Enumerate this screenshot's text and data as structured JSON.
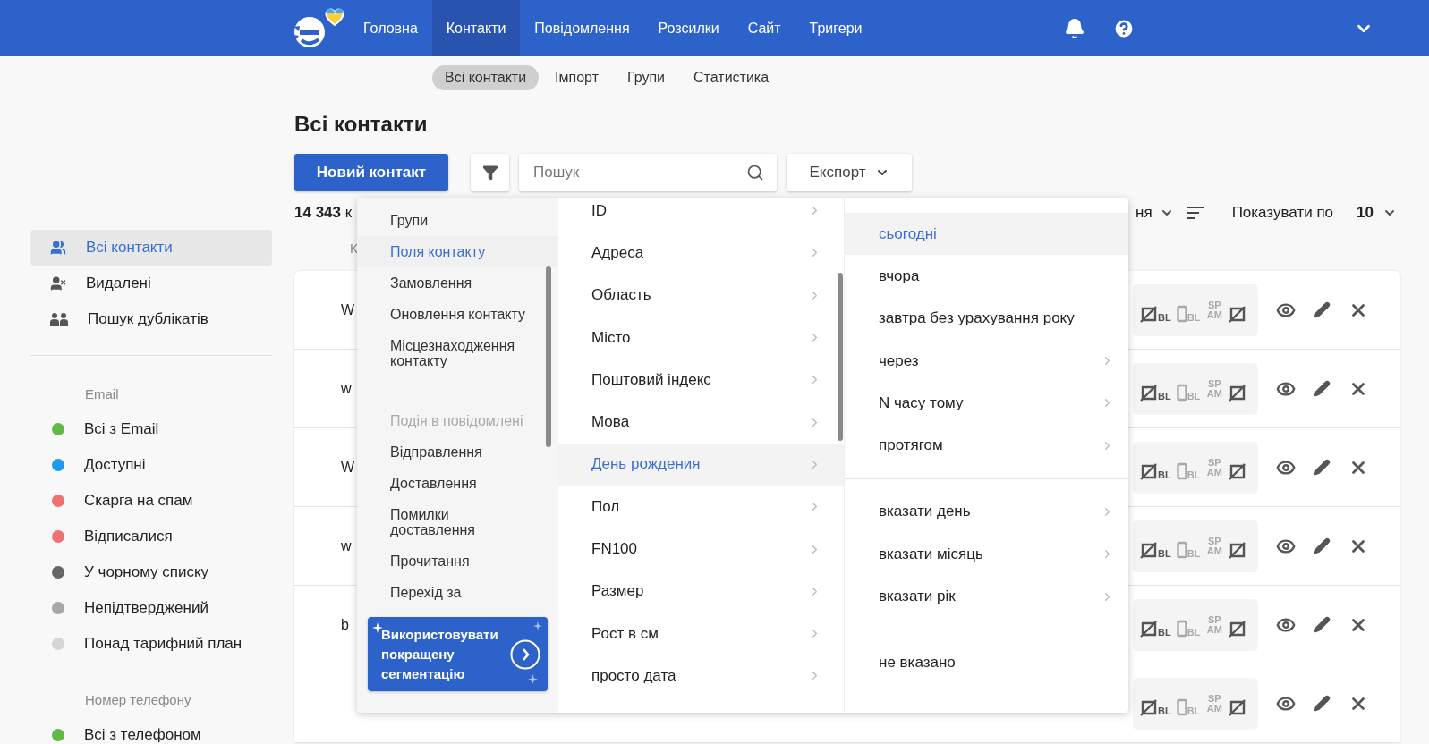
{
  "nav": {
    "items": [
      {
        "label": "Головна",
        "selected": false
      },
      {
        "label": "Контакти",
        "selected": true
      },
      {
        "label": "Повідомлення",
        "selected": false
      },
      {
        "label": "Розсилки",
        "selected": false
      },
      {
        "label": "Сайт",
        "selected": false
      },
      {
        "label": "Тригери",
        "selected": false
      }
    ]
  },
  "subnav": {
    "items": [
      {
        "label": "Всі контакти",
        "selected": true
      },
      {
        "label": "Імпорт",
        "selected": false
      },
      {
        "label": "Групи",
        "selected": false
      },
      {
        "label": "Статистика",
        "selected": false
      }
    ]
  },
  "sidebar": {
    "items": [
      {
        "label": "Всі контакти",
        "kind": "all",
        "selected": true
      },
      {
        "label": "Видалені",
        "kind": "deleted",
        "selected": false
      },
      {
        "label": "Пошук дублікатів",
        "kind": "duplicates",
        "selected": false
      }
    ],
    "groups": [
      {
        "title": "Email",
        "items": [
          {
            "label": "Всі з Email",
            "color": "#62b946"
          },
          {
            "label": "Доступні",
            "color": "#1e9bf0"
          },
          {
            "label": "Скарга на спам",
            "color": "#ef7171"
          },
          {
            "label": "Відписалися",
            "color": "#ef7171"
          },
          {
            "label": "У чорному списку",
            "color": "#666666"
          },
          {
            "label": "Непідтверджений",
            "color": "#a8a8a8"
          },
          {
            "label": "Понад тарифний план",
            "color": "#d6d6d6"
          }
        ]
      },
      {
        "title": "Номер телефону",
        "items": [
          {
            "label": "Всі з телефоном",
            "color": "#62b946"
          }
        ]
      }
    ]
  },
  "page": {
    "title": "Всі контакти",
    "new_button": "Новий контакт",
    "search_placeholder": "Пошук",
    "export_button": "Експорт",
    "count": "**14 343** к",
    "sort_label": "ня",
    "per_page_label": "Показувати по",
    "per_page": "10"
  },
  "table": {
    "column_1": "К",
    "rows": [
      {
        "cell": "W",
        "flags": [
          {
            "kind": "email",
            "label": "BL",
            "active": true
          },
          {
            "kind": "phone",
            "label": "BL",
            "active": false
          },
          {
            "kind": "spam",
            "label": "SP AM",
            "active": false
          },
          {
            "kind": "email_off",
            "active": true
          }
        ]
      },
      {
        "cell": "w",
        "flags": [
          {
            "kind": "email",
            "label": "BL",
            "active": true
          },
          {
            "kind": "phone",
            "label": "BL",
            "active": false
          },
          {
            "kind": "spam",
            "label": "SP AM",
            "active": false
          },
          {
            "kind": "email_off",
            "active": true
          }
        ]
      },
      {
        "cell": "W",
        "flags": [
          {
            "kind": "email",
            "label": "BL",
            "active": true
          },
          {
            "kind": "phone",
            "label": "BL",
            "active": false
          },
          {
            "kind": "spam",
            "label": "SP AM",
            "active": false
          },
          {
            "kind": "email_off",
            "active": true
          }
        ]
      },
      {
        "cell": "w",
        "flags": [
          {
            "kind": "email",
            "label": "BL",
            "active": true
          },
          {
            "kind": "phone",
            "label": "BL",
            "active": false
          },
          {
            "kind": "spam",
            "label": "SP AM",
            "active": false
          },
          {
            "kind": "email_off",
            "active": true
          }
        ]
      },
      {
        "cell": "b",
        "flags": [
          {
            "kind": "email",
            "label": "BL",
            "active": true
          },
          {
            "kind": "phone",
            "label": "BL",
            "active": false
          },
          {
            "kind": "spam",
            "label": "SP AM",
            "active": false
          },
          {
            "kind": "email_off",
            "active": true
          }
        ]
      },
      {
        "flags": [
          {
            "kind": "email",
            "label": "BL",
            "active": true
          },
          {
            "kind": "phone",
            "label": "BL",
            "active": false
          },
          {
            "kind": "spam",
            "label": "SP AM",
            "active": false
          },
          {
            "kind": "email_off",
            "active": true
          }
        ]
      }
    ]
  },
  "filter_menu": {
    "categories": [
      {
        "kind": "item",
        "label": "Групи",
        "selected": false
      },
      {
        "kind": "item",
        "label": "Поля контакту",
        "selected": true
      },
      {
        "kind": "item",
        "label": "Замовлення",
        "selected": false
      },
      {
        "kind": "item",
        "label": "Оновлення контакту",
        "selected": false
      },
      {
        "kind": "item",
        "label": "Місцезнаходження контакту",
        "selected": false
      },
      {
        "kind": "heading",
        "label": "Подія в повідомлені"
      },
      {
        "kind": "item",
        "label": "Відправлення",
        "selected": false
      },
      {
        "kind": "item",
        "label": "Доставлення",
        "selected": false
      },
      {
        "kind": "item",
        "label": "Помилки доставлення",
        "selected": false
      },
      {
        "kind": "item",
        "label": "Прочитання",
        "selected": false
      },
      {
        "kind": "item",
        "label": "Перехід за",
        "selected": false
      }
    ],
    "promo": "Використовувати покращену сегментацію",
    "fields": [
      {
        "label": "ID",
        "selected": false
      },
      {
        "label": "Адреса",
        "selected": false
      },
      {
        "label": "Область",
        "selected": false
      },
      {
        "label": "Місто",
        "selected": false
      },
      {
        "label": "Поштовий індекс",
        "selected": false
      },
      {
        "label": "Мова",
        "selected": false
      },
      {
        "label": "День рождения",
        "selected": true
      },
      {
        "label": "Пол",
        "selected": false
      },
      {
        "label": "FN100",
        "selected": false
      },
      {
        "label": "Размер",
        "selected": false
      },
      {
        "label": "Рост в см",
        "selected": false
      },
      {
        "label": "просто дата",
        "selected": false
      }
    ],
    "option_groups": [
      {
        "items": [
          {
            "label": "сьогодні",
            "submenu": false,
            "selected": true
          },
          {
            "label": "вчора",
            "submenu": false,
            "selected": false
          },
          {
            "label": "завтра без урахування року",
            "submenu": false,
            "selected": false
          },
          {
            "label": "через",
            "submenu": true,
            "selected": false
          },
          {
            "label": "N часу тому",
            "submenu": true,
            "selected": false
          },
          {
            "label": "протягом",
            "submenu": true,
            "selected": false
          }
        ]
      },
      {
        "items": [
          {
            "label": "вказати день",
            "submenu": true,
            "selected": false
          },
          {
            "label": "вказати місяць",
            "submenu": true,
            "selected": false
          },
          {
            "label": "вказати рік",
            "submenu": true,
            "selected": false
          }
        ]
      },
      {
        "items": [
          {
            "label": "не вказано",
            "submenu": false,
            "selected": false
          }
        ]
      }
    ]
  }
}
